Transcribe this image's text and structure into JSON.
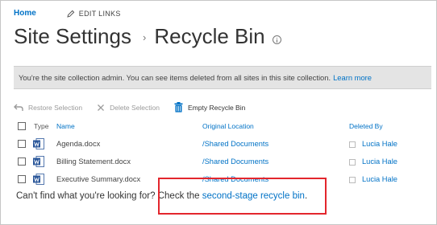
{
  "nav": {
    "home": "Home",
    "edit_links": "EDIT LINKS"
  },
  "title": {
    "parent": "Site Settings",
    "separator": "›",
    "current": "Recycle Bin"
  },
  "notice": {
    "text": "You're the site collection admin. You can see items deleted from all sites in this site collection.",
    "link": "Learn more"
  },
  "toolbar": {
    "restore": "Restore Selection",
    "delete": "Delete Selection",
    "empty": "Empty Recycle Bin"
  },
  "table": {
    "headers": {
      "type": "Type",
      "name": "Name",
      "location": "Original Location",
      "deleted_by": "Deleted By"
    },
    "rows": [
      {
        "name": "Agenda.docx",
        "location": "/Shared Documents",
        "deleted_by": "Lucia Hale"
      },
      {
        "name": "Billing Statement.docx",
        "location": "/Shared Documents",
        "deleted_by": "Lucia Hale"
      },
      {
        "name": "Executive Summary.docx",
        "location": "/Shared Documents",
        "deleted_by": "Lucia Hale"
      }
    ]
  },
  "footer": {
    "prefix": "Can't find what you're looking for?",
    "check": "Check the",
    "link": "second-stage recycle bin",
    "suffix": "."
  },
  "colors": {
    "accent": "#0072c6",
    "highlight_box": "#e3262d",
    "notice_bg": "#e4e4e4"
  }
}
